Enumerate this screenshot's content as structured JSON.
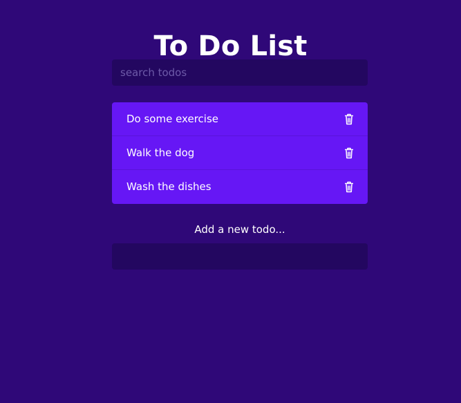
{
  "header": {
    "title": "To Do List"
  },
  "search": {
    "placeholder": "search todos",
    "value": ""
  },
  "todos": [
    {
      "label": "Do some exercise",
      "delete_icon": "trash-icon"
    },
    {
      "label": "Walk the dog",
      "delete_icon": "trash-icon"
    },
    {
      "label": "Wash the dishes",
      "delete_icon": "trash-icon"
    }
  ],
  "add": {
    "label": "Add a new todo...",
    "value": ""
  },
  "colors": {
    "background": "#2f0878",
    "input_background": "#230760",
    "list_background": "#6617f5",
    "text": "#ffffff"
  }
}
